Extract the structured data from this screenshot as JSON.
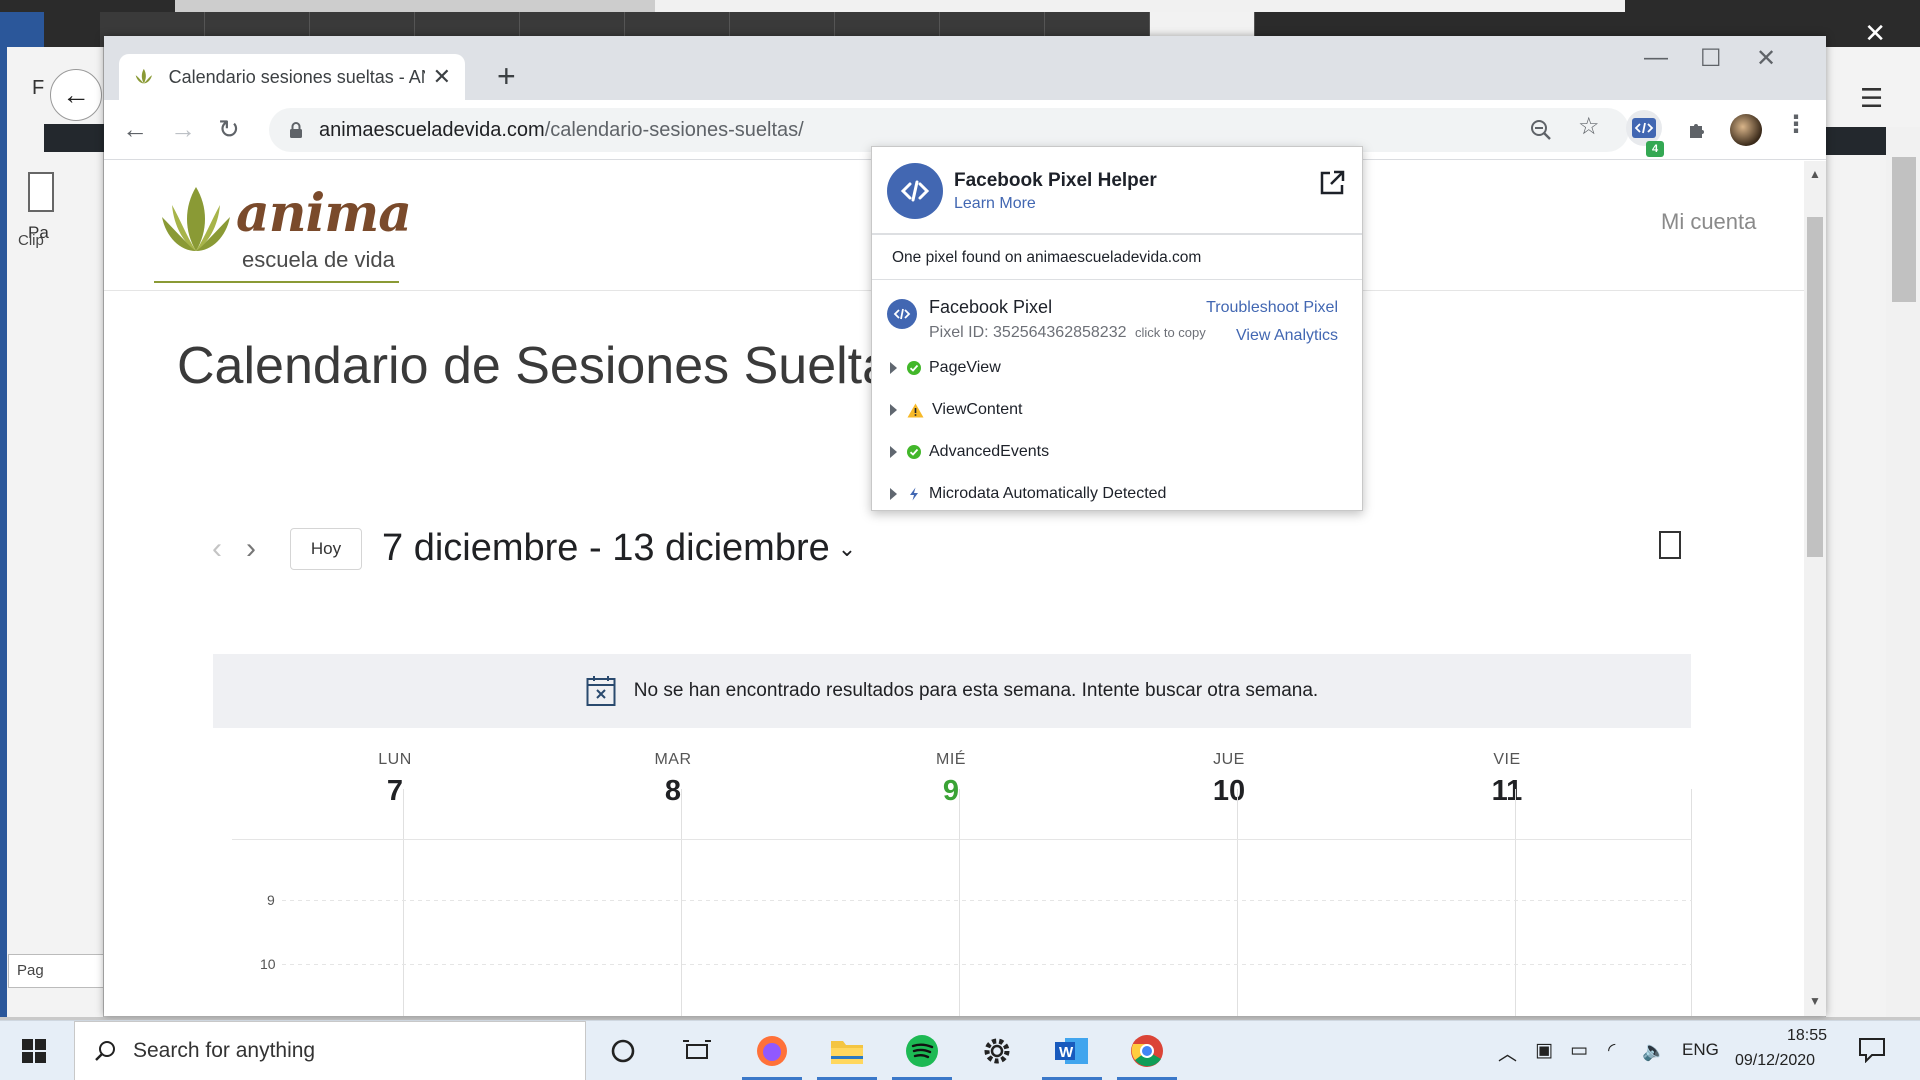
{
  "browser": {
    "tab_title": "Calendario sesiones sueltas - ANIMA",
    "url_host": "animaescueladevida.com",
    "url_path": "/calendario-sesiones-sueltas/",
    "extension_badge": "4"
  },
  "site": {
    "logo_word": "anima",
    "logo_sub": "escuela de vida",
    "account_link": "Mi cuenta",
    "page_title": "Calendario de Sesiones Sueltas"
  },
  "calendar": {
    "today_button": "Hoy",
    "range_label": "7 diciembre - 13 diciembre",
    "notice": "No se han encontrado resultados para esta semana. Intente buscar otra semana.",
    "days": [
      {
        "name": "LUN",
        "num": "7"
      },
      {
        "name": "MAR",
        "num": "8"
      },
      {
        "name": "MIÉ",
        "num": "9"
      },
      {
        "name": "JUE",
        "num": "10"
      },
      {
        "name": "VIE",
        "num": "11"
      }
    ],
    "today_index": 2,
    "hours": [
      "9",
      "10"
    ],
    "today_color": "#3aa335"
  },
  "pixel_helper": {
    "title": "Facebook Pixel Helper",
    "learn_more": "Learn More",
    "found_text": "One pixel found on animaescueladevida.com",
    "pixel_name": "Facebook Pixel",
    "pixel_id": "Pixel ID: 352564362858232",
    "click_to_copy": "click to copy",
    "troubleshoot": "Troubleshoot Pixel",
    "view_analytics": "View Analytics",
    "events": [
      {
        "label": "PageView",
        "status": "success"
      },
      {
        "label": "ViewContent",
        "status": "warning"
      },
      {
        "label": "AdvancedEvents",
        "status": "success"
      },
      {
        "label": "Microdata Automatically Detected",
        "status": "info"
      }
    ],
    "brand_color": "#4267b2"
  },
  "taskbar": {
    "search_placeholder": "Search for anything",
    "language": "ENG",
    "time": "18:55",
    "date": "09/12/2020"
  },
  "background": {
    "left_word_label": "Pa",
    "left_clip_label": "Clip",
    "left_status": "Pag"
  }
}
